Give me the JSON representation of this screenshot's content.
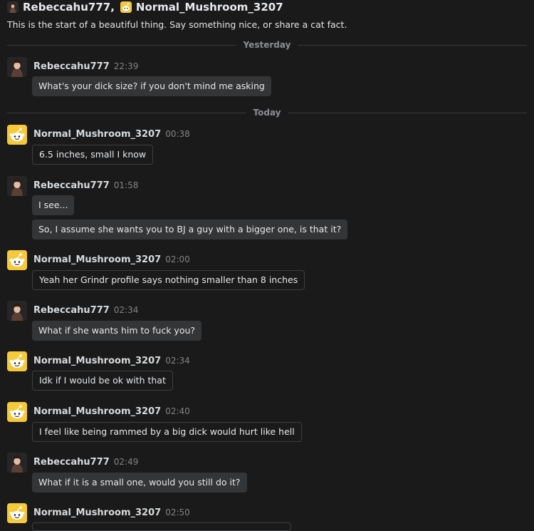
{
  "header": {
    "user1": "Rebeccahu777,",
    "user2": "Normal_Mushroom_3207",
    "intro": "This is the start of a beautiful thing. Say something nice, or share a cat fact."
  },
  "dividers": {
    "yesterday": "Yesterday",
    "today": "Today"
  },
  "messages": [
    {
      "author": "Rebeccahu777",
      "time": "22:39",
      "lines": [
        "What's your dick size? if you don't mind me asking"
      ]
    },
    {
      "author": "Normal_Mushroom_3207",
      "time": "00:38",
      "lines": [
        "6.5 inches, small I know"
      ]
    },
    {
      "author": "Rebeccahu777",
      "time": "01:58",
      "lines": [
        "I see...",
        "So, I assume she wants you to BJ a guy with a bigger one, is that it?"
      ]
    },
    {
      "author": "Normal_Mushroom_3207",
      "time": "02:00",
      "lines": [
        "Yeah her Grindr profile says nothing smaller than 8 inches"
      ]
    },
    {
      "author": "Rebeccahu777",
      "time": "02:34",
      "lines": [
        "What if she wants him to fuck you?"
      ]
    },
    {
      "author": "Normal_Mushroom_3207",
      "time": "02:34",
      "lines": [
        "Idk if I would be ok with that"
      ]
    },
    {
      "author": "Normal_Mushroom_3207",
      "time": "02:40",
      "lines": [
        "I feel like being rammed by a big dick would hurt like hell"
      ]
    },
    {
      "author": "Rebeccahu777",
      "time": "02:49",
      "lines": [
        "What if it is a small one, would you still do it?"
      ]
    },
    {
      "author": "Normal_Mushroom_3207",
      "time": "02:50",
      "lines": []
    }
  ]
}
